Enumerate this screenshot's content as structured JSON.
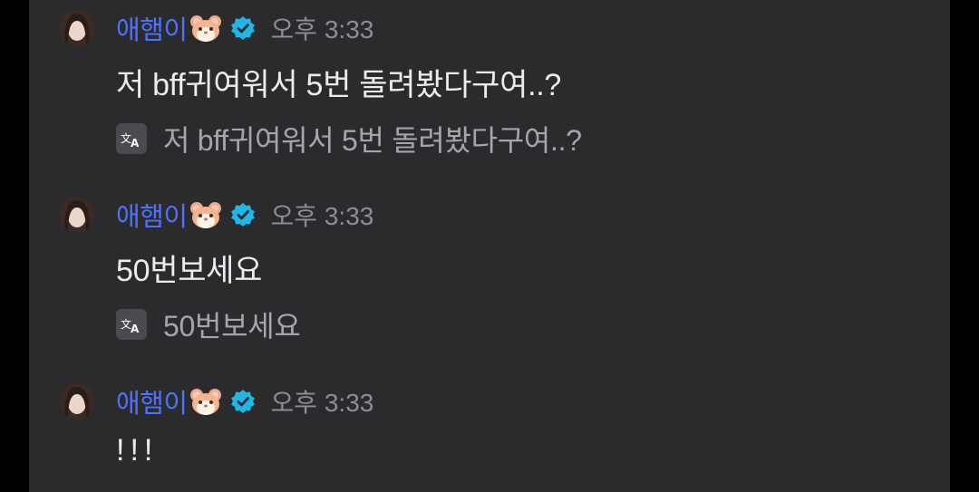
{
  "messages": [
    {
      "username": "애햄이",
      "time": "오후 3:33",
      "text": "저 bff귀여워서 5번 돌려봤다구여..?",
      "translation": "저 bff귀여워서 5번 돌려봤다구여..?"
    },
    {
      "username": "애햄이",
      "time": "오후 3:33",
      "text": "50번보세요",
      "translation": "50번보세요"
    },
    {
      "username": "애햄이",
      "time": "오후 3:33",
      "text": "!!!",
      "translation": ""
    }
  ],
  "icons": {
    "avatar": "avatar-photo",
    "hamster": "hamster-emoji-icon",
    "verified": "verified-badge-icon",
    "translate": "translate-icon"
  },
  "colors": {
    "background": "#2b2b2d",
    "username": "#4b73ff",
    "verified": "#1fb7e6",
    "timestamp": "#8d8e94",
    "message_text": "#ececef",
    "translation_text": "#a5a6ab"
  }
}
